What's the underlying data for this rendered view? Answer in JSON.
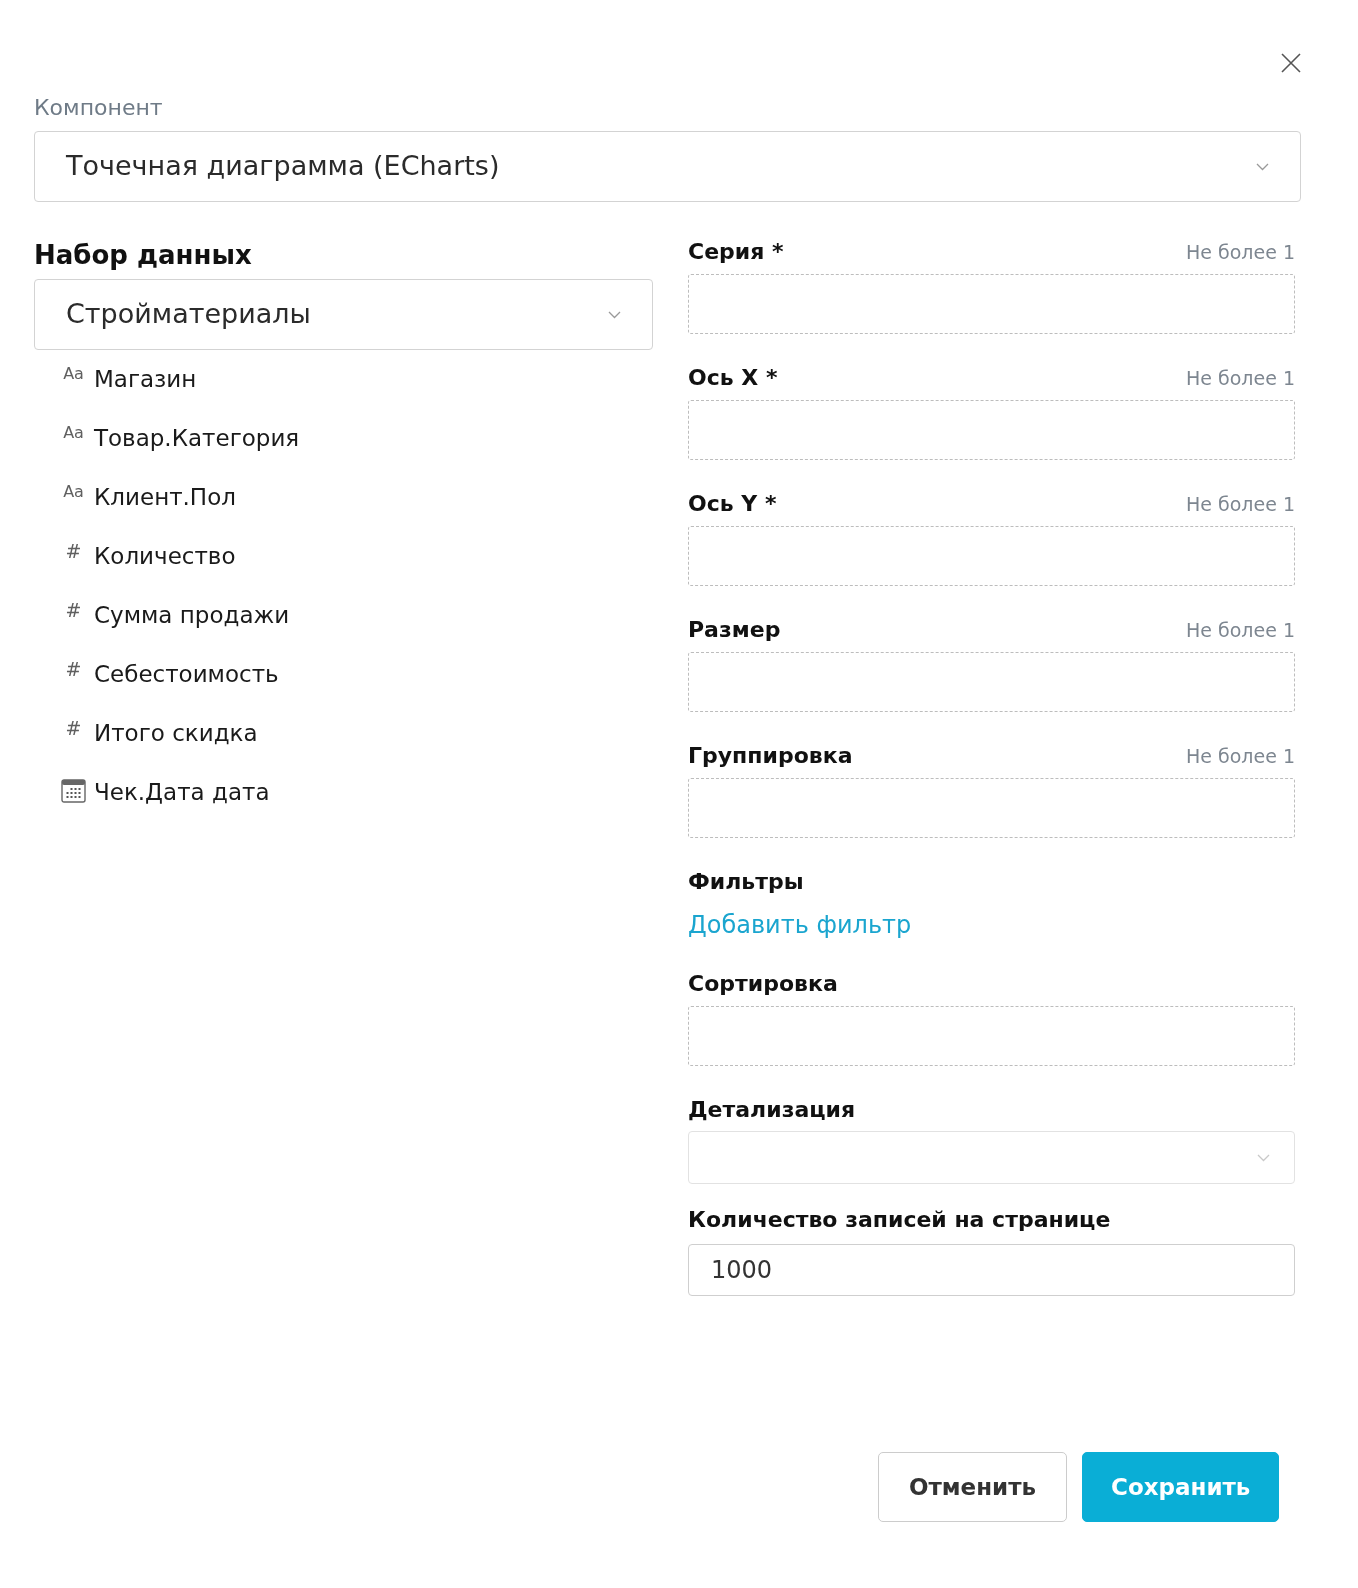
{
  "component": {
    "label": "Компонент",
    "value": "Точечная диаграмма (ECharts)"
  },
  "dataset": {
    "title": "Набор данных",
    "value": "Стройматериалы",
    "fields": [
      {
        "kind": "text",
        "glyph": "Aa",
        "name": "Магазин"
      },
      {
        "kind": "text",
        "glyph": "Aa",
        "name": "Товар.Категория"
      },
      {
        "kind": "text",
        "glyph": "Aa",
        "name": "Клиент.Пол"
      },
      {
        "kind": "number",
        "glyph": "#",
        "name": "Количество"
      },
      {
        "kind": "number",
        "glyph": "#",
        "name": "Сумма продажи"
      },
      {
        "kind": "number",
        "glyph": "#",
        "name": "Себестоимость"
      },
      {
        "kind": "number",
        "glyph": "#",
        "name": "Итого скидка"
      },
      {
        "kind": "date",
        "name": "Чек.Дата дата"
      }
    ]
  },
  "settings": [
    {
      "kind": "dropzone",
      "label": "Серия *",
      "limit": "Не более 1"
    },
    {
      "kind": "dropzone",
      "label": "Ось X *",
      "limit": "Не более 1"
    },
    {
      "kind": "dropzone",
      "label": "Ось Y *",
      "limit": "Не более 1"
    },
    {
      "kind": "dropzone",
      "label": "Размер",
      "limit": "Не более 1"
    },
    {
      "kind": "dropzone",
      "label": "Группировка",
      "limit": "Не более 1"
    },
    {
      "kind": "link",
      "label": "Фильтры",
      "link": "Добавить фильтр"
    },
    {
      "kind": "dropzone",
      "label": "Сортировка"
    },
    {
      "kind": "select",
      "label": "Детализация"
    },
    {
      "kind": "input",
      "label": "Количество записей на странице",
      "value": "1000"
    }
  ],
  "buttons": [
    {
      "kind": "secondary",
      "label": "Отменить"
    },
    {
      "kind": "primary",
      "label": "Сохранить"
    }
  ]
}
